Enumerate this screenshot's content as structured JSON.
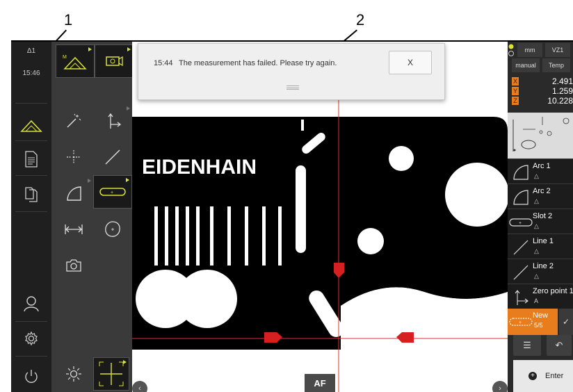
{
  "callouts": {
    "one": "1",
    "two": "2"
  },
  "status_bar": {
    "counter": "Δ1",
    "clock": "15:46"
  },
  "main_menu": {
    "items": [
      {
        "name": "measure",
        "icon": "measure-triangle-icon",
        "active": true
      },
      {
        "name": "measurement-report",
        "icon": "report-document-icon",
        "active": false
      },
      {
        "name": "file-management",
        "icon": "files-icon",
        "active": false
      },
      {
        "name": "user-login",
        "icon": "user-icon",
        "active": false
      },
      {
        "name": "settings",
        "icon": "gear-icon",
        "active": false
      },
      {
        "name": "switch-off",
        "icon": "power-icon",
        "active": false
      }
    ]
  },
  "tool_palette": {
    "top": [
      "measure-triangle-sensor-icon",
      "video-sensor-icon"
    ],
    "grid": [
      "measure-magic-icon",
      "reference-system-icon",
      "point-icon",
      "line-icon",
      "arc-icon",
      "slot-icon",
      "distance-icon",
      "circle-icon",
      "image-capture-icon"
    ],
    "bottom": [
      "light-settings-icon",
      "crosshair-icon"
    ]
  },
  "message": {
    "time": "15:44",
    "text": "The measurement has failed. Please try again.",
    "close_label": "X"
  },
  "workspace": {
    "af_label": "AF",
    "brand_text": "EIDENHAIN"
  },
  "right_panel": {
    "unit": "mm",
    "variant": "VZ1",
    "mode": "manual",
    "temp_label": "Temp",
    "coords": [
      {
        "axis": "X",
        "value": "2.491"
      },
      {
        "axis": "Y",
        "value": "1.259"
      },
      {
        "axis": "Z",
        "value": "10.228"
      }
    ],
    "features": [
      {
        "name": "Arc 1",
        "icon": "arc-icon"
      },
      {
        "name": "Arc 2",
        "icon": "arc-icon"
      },
      {
        "name": "Slot 2",
        "icon": "slot-icon"
      },
      {
        "name": "Line 1",
        "icon": "line-icon"
      },
      {
        "name": "Line 2",
        "icon": "line-icon"
      },
      {
        "name": "Zero point 1",
        "icon": "zero-point-icon"
      }
    ],
    "new_feature": {
      "name": "New",
      "count": "5/5"
    },
    "enter_label": "Enter"
  },
  "colors": {
    "accent": "#d9e23a",
    "orange": "#e87d1e",
    "marker": "#d42020"
  }
}
